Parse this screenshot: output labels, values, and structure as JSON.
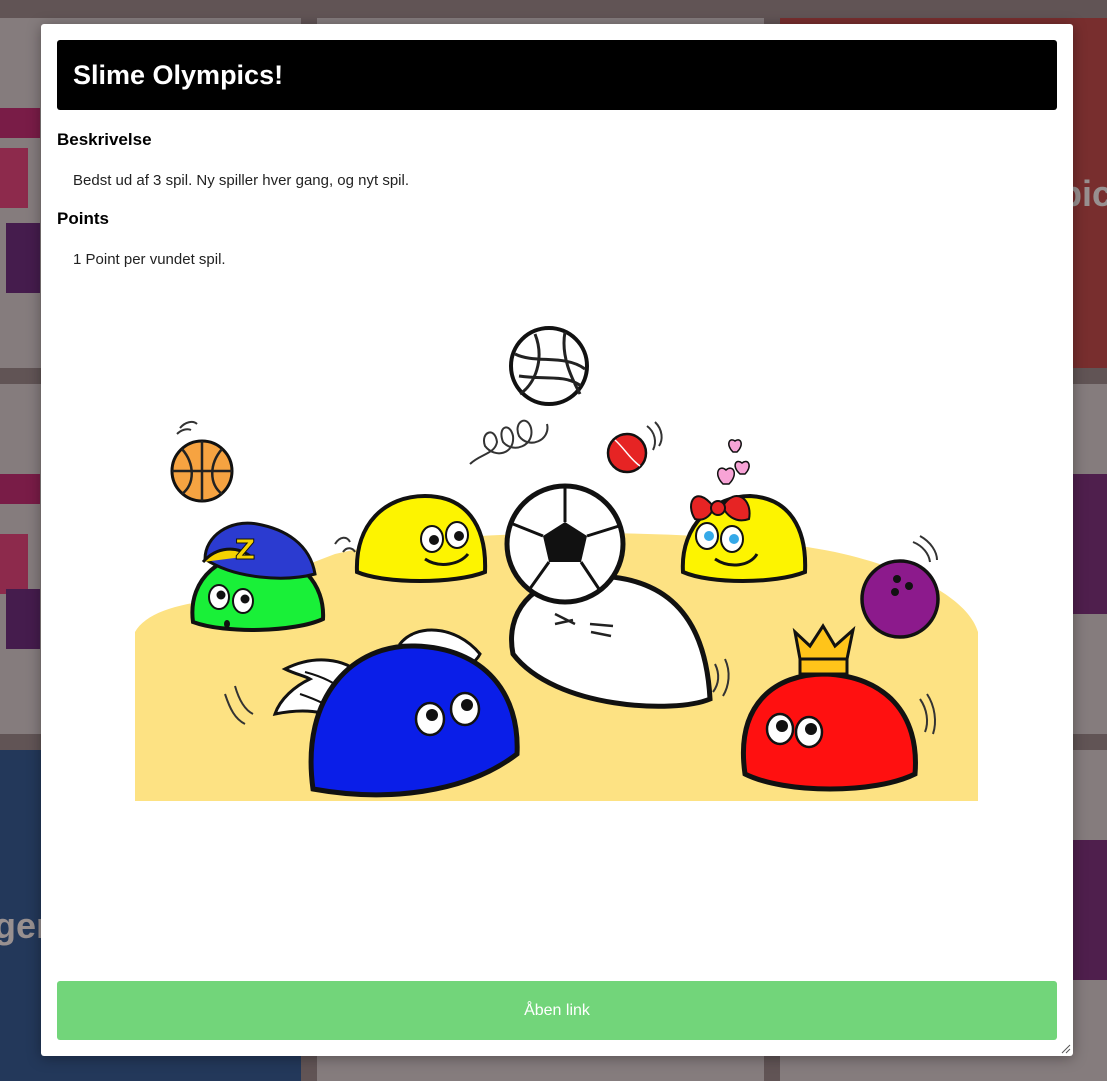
{
  "background": {
    "cards": [
      {
        "text": ""
      },
      {
        "text": ""
      },
      {
        "text": "pic"
      },
      {
        "text": ""
      },
      {
        "text": ""
      },
      {
        "text": ""
      },
      {
        "text": "ger"
      },
      {
        "text": ""
      },
      {
        "text": ""
      }
    ]
  },
  "modal": {
    "title": "Slime Olympics!",
    "description_heading": "Beskrivelse",
    "description_text": "Bedst ud af 3 spil. Ny spiller hver gang, og nyt spil.",
    "points_heading": "Points",
    "points_text": "1 Point per vundet spil.",
    "open_button_label": "Åben link"
  },
  "colors": {
    "header_bg": "#000000",
    "button_bg": "#72d57a",
    "sand": "#fde283"
  },
  "illustration": {
    "icons": [
      "volleyball-icon",
      "basketball-icon",
      "cricket-ball-icon",
      "soccer-ball-icon",
      "bowling-ball-icon",
      "crown-icon",
      "cap-icon",
      "bow-icon",
      "hearts-icon",
      "wings-icon"
    ]
  }
}
